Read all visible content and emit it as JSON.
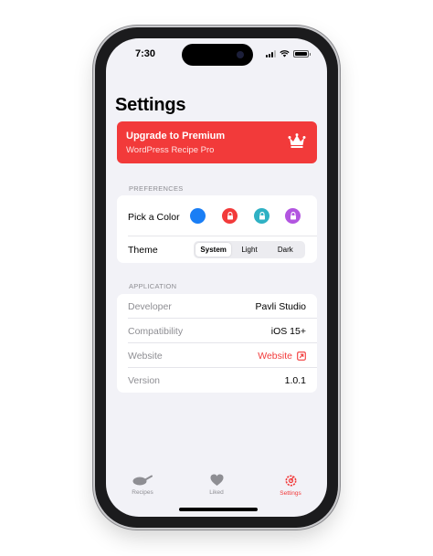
{
  "status_bar": {
    "time": "7:30"
  },
  "page_title": "Settings",
  "premium": {
    "title": "Upgrade to Premium",
    "subtitle": "WordPress Recipe Pro",
    "icon": "crown-icon"
  },
  "preferences": {
    "header": "Preferences",
    "pick_color_label": "Pick a Color",
    "colors": [
      {
        "name": "blue",
        "hex": "#1a7ef5",
        "locked": false
      },
      {
        "name": "red",
        "hex": "#f23a3a",
        "locked": true
      },
      {
        "name": "teal",
        "hex": "#2fb1c4",
        "locked": true
      },
      {
        "name": "purple",
        "hex": "#b255e0",
        "locked": true
      }
    ],
    "theme_label": "Theme",
    "theme_options": [
      "System",
      "Light",
      "Dark"
    ],
    "theme_selected": "System"
  },
  "application": {
    "header": "Application",
    "rows": [
      {
        "label": "Developer",
        "value": "Pavli Studio"
      },
      {
        "label": "Compatibility",
        "value": "iOS 15+"
      },
      {
        "label": "Website",
        "value": "Website",
        "icon": "external-link-icon"
      },
      {
        "label": "Version",
        "value": "1.0.1"
      }
    ]
  },
  "tabs": [
    {
      "label": "Recipes",
      "icon": "pan-icon",
      "active": false
    },
    {
      "label": "Liked",
      "icon": "heart-icon",
      "active": false
    },
    {
      "label": "Settings",
      "icon": "gear-icon",
      "active": true
    }
  ],
  "colors": {
    "accent": "#f23a3a",
    "background": "#f2f2f7"
  }
}
